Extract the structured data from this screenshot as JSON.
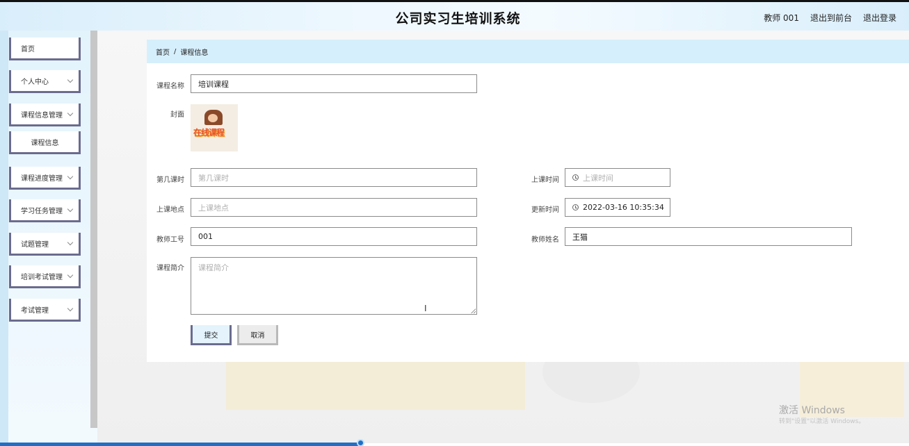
{
  "header": {
    "title": "公司实习生培训系统",
    "links": [
      "教师 001",
      "退出到前台",
      "退出登录"
    ]
  },
  "sidebar": {
    "items": [
      {
        "label": "首页",
        "has_chevron": false
      },
      {
        "label": "个人中心",
        "has_chevron": true
      },
      {
        "label": "课程信息管理",
        "has_chevron": true
      },
      {
        "label": "课程信息",
        "has_chevron": false,
        "sub": true
      },
      {
        "label": "课程进度管理",
        "has_chevron": true
      },
      {
        "label": "学习任务管理",
        "has_chevron": true
      },
      {
        "label": "试题管理",
        "has_chevron": true
      },
      {
        "label": "培训考试管理",
        "has_chevron": true
      },
      {
        "label": "考试管理",
        "has_chevron": true
      }
    ]
  },
  "breadcrumb": {
    "home": "首页",
    "separator": "/",
    "current": "课程信息"
  },
  "form": {
    "course_name": {
      "label": "课程名称",
      "value": "培训课程"
    },
    "cover": {
      "label": "封面",
      "image_text": "在线课程"
    },
    "lesson_no": {
      "label": "第几课时",
      "value": "",
      "placeholder": "第几课时"
    },
    "class_time": {
      "label": "上课时间",
      "value": "",
      "placeholder": "上课时间"
    },
    "class_location": {
      "label": "上课地点",
      "value": "",
      "placeholder": "上课地点"
    },
    "update_time": {
      "label": "更新时间",
      "value": "2022-03-16 10:35:34"
    },
    "teacher_id": {
      "label": "教师工号",
      "value": "001"
    },
    "teacher_name": {
      "label": "教师姓名",
      "value": "王猫"
    },
    "intro": {
      "label": "课程简介",
      "value": "",
      "placeholder": "课程简介"
    }
  },
  "buttons": {
    "submit": "提交",
    "cancel": "取消"
  },
  "watermark": {
    "line1": "激活 Windows",
    "line2": "转到\"设置\"以激活 Windows。"
  },
  "colors": {
    "header_bg": "#d9eefb",
    "breadcrumb_bg": "#d6effc",
    "accent_border": "#6b6b8e"
  }
}
